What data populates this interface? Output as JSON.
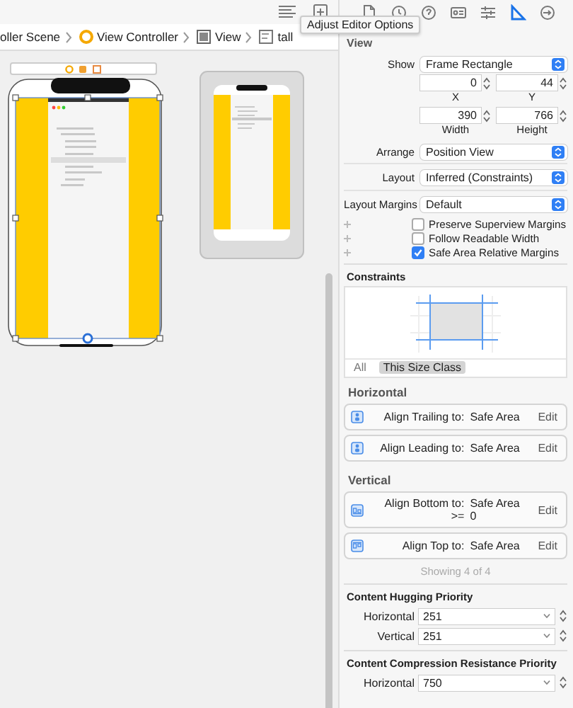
{
  "tooltip": {
    "text": "Adjust Editor Options"
  },
  "editor_buttons": [
    {
      "kind": "lines"
    },
    {
      "kind": "adjust"
    }
  ],
  "inspector_tabs": [
    {
      "kind": "file",
      "selected": false
    },
    {
      "kind": "history",
      "selected": false
    },
    {
      "kind": "help",
      "selected": false
    },
    {
      "kind": "identity",
      "selected": false
    },
    {
      "kind": "attributes",
      "selected": false
    },
    {
      "kind": "size",
      "selected": true
    },
    {
      "kind": "connections",
      "selected": false
    }
  ],
  "breadcrumb": [
    {
      "label": "oller Scene",
      "kind": "scene"
    },
    {
      "label": "View Controller",
      "kind": "controller"
    },
    {
      "label": "View",
      "kind": "view"
    },
    {
      "label": "tall",
      "kind": "file"
    }
  ],
  "inspector": {
    "section_title": "View",
    "show": {
      "label": "Show",
      "value": "Frame Rectangle"
    },
    "frame_fields": [
      {
        "value": "0",
        "caption": "X"
      },
      {
        "value": "44",
        "caption": "Y"
      },
      {
        "value": "390",
        "caption": "Width"
      },
      {
        "value": "766",
        "caption": "Height"
      }
    ],
    "arrange": {
      "label": "Arrange",
      "value": "Position View"
    },
    "layout": {
      "label": "Layout",
      "value": "Inferred (Constraints)"
    },
    "layout_margins": {
      "label": "Layout Margins",
      "value": "Default"
    },
    "checkboxes": [
      {
        "label": "Preserve Superview Margins",
        "checked": false
      },
      {
        "label": "Follow Readable Width",
        "checked": false
      },
      {
        "label": "Safe Area Relative Margins",
        "checked": true
      }
    ],
    "constraints": {
      "title": "Constraints",
      "scope_tabs": [
        {
          "label": "All",
          "selected": false
        },
        {
          "label": "This Size Class",
          "selected": true
        }
      ],
      "groups": [
        {
          "title": "Horizontal",
          "items": [
            {
              "kind": "trailing",
              "text": "Align Trailing to:",
              "target": "Safe Area",
              "action": "Edit"
            },
            {
              "kind": "leading",
              "text": "Align Leading to:",
              "target": "Safe Area",
              "action": "Edit"
            }
          ]
        },
        {
          "title": "Vertical",
          "items": [
            {
              "kind": "bottom",
              "text": "Align Bottom to:",
              "target": "Safe Area",
              "relation": ">=",
              "constant": "0",
              "action": "Edit"
            },
            {
              "kind": "top",
              "text": "Align Top to:",
              "target": "Safe Area",
              "action": "Edit"
            }
          ]
        }
      ],
      "footer": "Showing 4 of 4"
    },
    "hugging": {
      "title": "Content Hugging Priority",
      "rows": [
        {
          "label": "Horizontal",
          "value": "251"
        },
        {
          "label": "Vertical",
          "value": "251"
        }
      ]
    },
    "compression": {
      "title": "Content Compression Resistance Priority",
      "rows": [
        {
          "label": "Horizontal",
          "value": "750"
        }
      ]
    }
  }
}
